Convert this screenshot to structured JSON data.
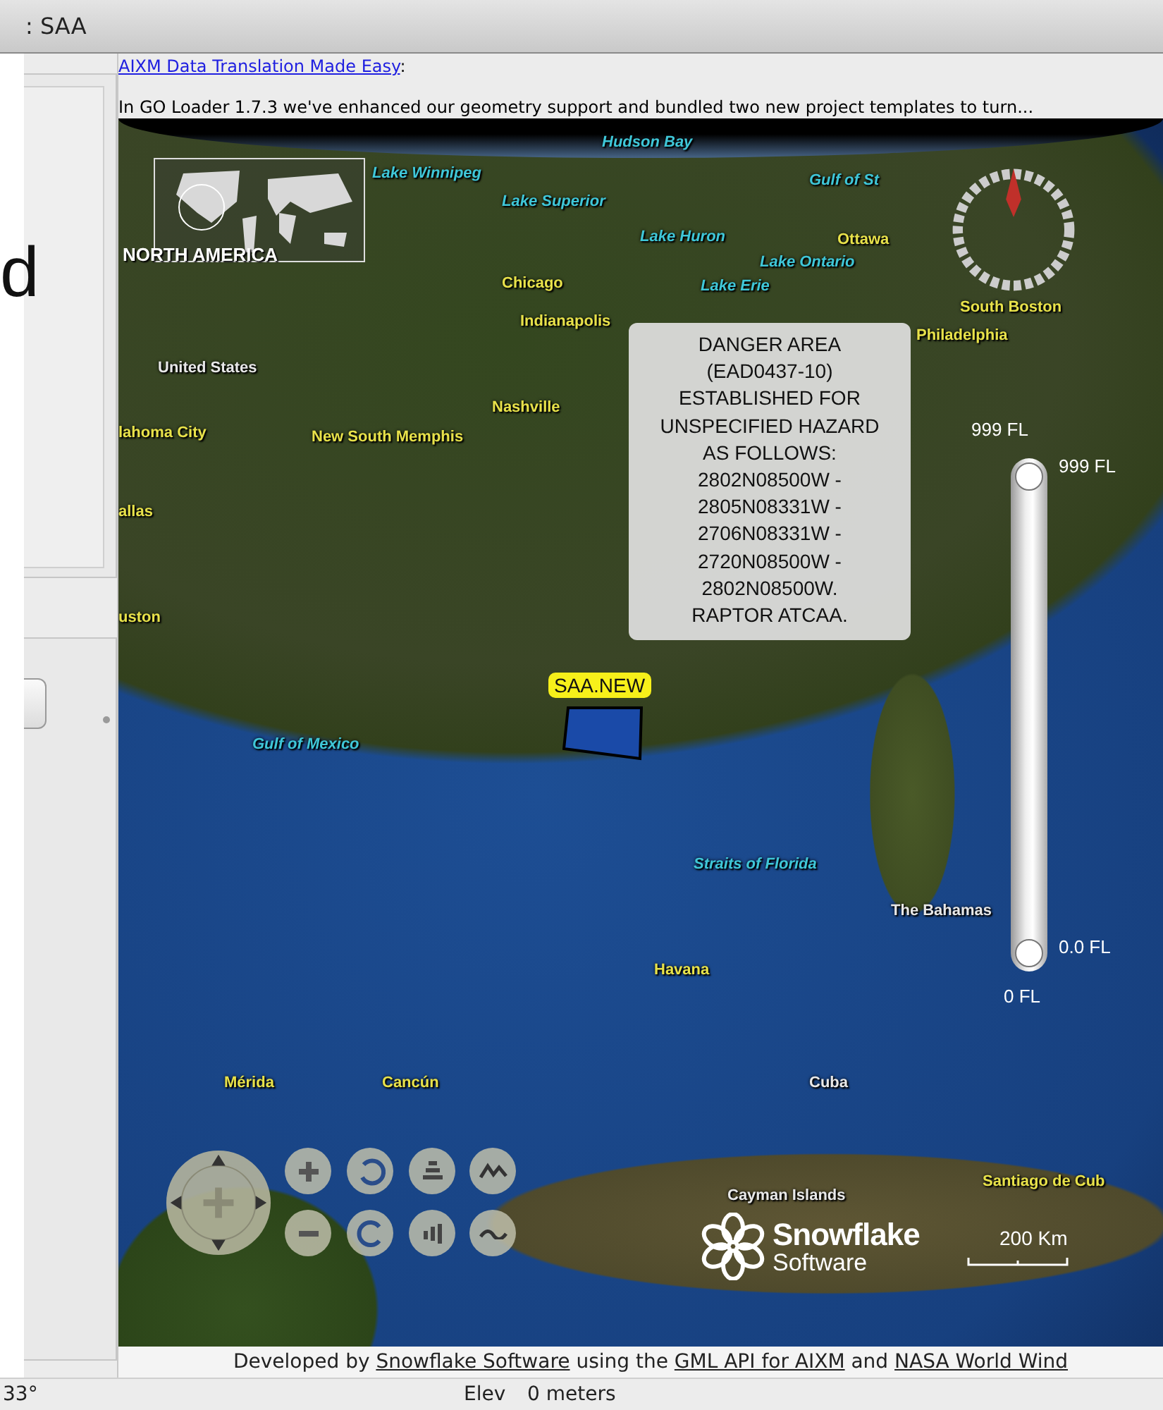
{
  "window": {
    "title": ": SAA"
  },
  "side": {
    "overlay_text": "d"
  },
  "news": {
    "link": "AIXM Data Translation Made Easy",
    "link_suffix": ":",
    "summary": "In GO Loader 1.7.3 we've enhanced our geometry support and bundled two new project templates to turn..."
  },
  "map": {
    "inset_label": "NORTH AMERICA",
    "labels": [
      {
        "text": "Hudson Bay",
        "kind": "water"
      },
      {
        "text": "Lake Winnipeg",
        "kind": "water"
      },
      {
        "text": "Lake Superior",
        "kind": "water"
      },
      {
        "text": "Lake Huron",
        "kind": "water"
      },
      {
        "text": "Lake Ontario",
        "kind": "water"
      },
      {
        "text": "Lake Erie",
        "kind": "water"
      },
      {
        "text": "Gulf of St",
        "kind": "water"
      },
      {
        "text": "Ottawa",
        "kind": "city"
      },
      {
        "text": "Chicago",
        "kind": "city"
      },
      {
        "text": "Indianapolis",
        "kind": "city"
      },
      {
        "text": "Philadelphia",
        "kind": "city"
      },
      {
        "text": "South Boston",
        "kind": "city"
      },
      {
        "text": "United States",
        "kind": "country"
      },
      {
        "text": "Nashville",
        "kind": "city"
      },
      {
        "text": "lahoma City",
        "kind": "city"
      },
      {
        "text": "New South Memphis",
        "kind": "city"
      },
      {
        "text": "allas",
        "kind": "city"
      },
      {
        "text": "uston",
        "kind": "city"
      },
      {
        "text": "Gulf of Mexico",
        "kind": "water"
      },
      {
        "text": "Straits of Florida",
        "kind": "water"
      },
      {
        "text": "The Bahamas",
        "kind": "country"
      },
      {
        "text": "Havana",
        "kind": "city"
      },
      {
        "text": "Mérida",
        "kind": "city"
      },
      {
        "text": "Cancún",
        "kind": "city"
      },
      {
        "text": "Cuba",
        "kind": "country"
      },
      {
        "text": "Santiago de Cub",
        "kind": "city"
      },
      {
        "text": "Cayman Islands",
        "kind": "country"
      }
    ],
    "tooltip": [
      "DANGER AREA",
      "(EAD0437-10)",
      "ESTABLISHED FOR",
      "UNSPECIFIED HAZARD",
      "AS FOLLOWS:",
      "2802N08500W -",
      "2805N08331W -",
      "2706N08331W -",
      "2720N08500W -",
      "2802N08500W.",
      "RAPTOR ATCAA."
    ],
    "area_label": "SAA.NEW",
    "altitude": {
      "max_label": "999 FL",
      "upper_value": "999 FL",
      "lower_value": "0.0 FL",
      "min_label": "0 FL",
      "thumbs": [
        {
          "level": 1
        },
        {
          "level": 0
        }
      ]
    },
    "logo": {
      "name": "Snowflake",
      "sub": "Software"
    },
    "scale": "200 Km"
  },
  "credits": [
    {
      "kind": "text",
      "text": "Developed by "
    },
    {
      "kind": "link",
      "text": "Snowflake Software"
    },
    {
      "kind": "text",
      "text": " using the "
    },
    {
      "kind": "link",
      "text": "GML API for AIXM"
    },
    {
      "kind": "text",
      "text": " and "
    },
    {
      "kind": "link",
      "text": "NASA World Wind"
    }
  ],
  "status_bar": {
    "heading": "33°",
    "elev_label": "Elev",
    "elev_value": "0 meters"
  }
}
